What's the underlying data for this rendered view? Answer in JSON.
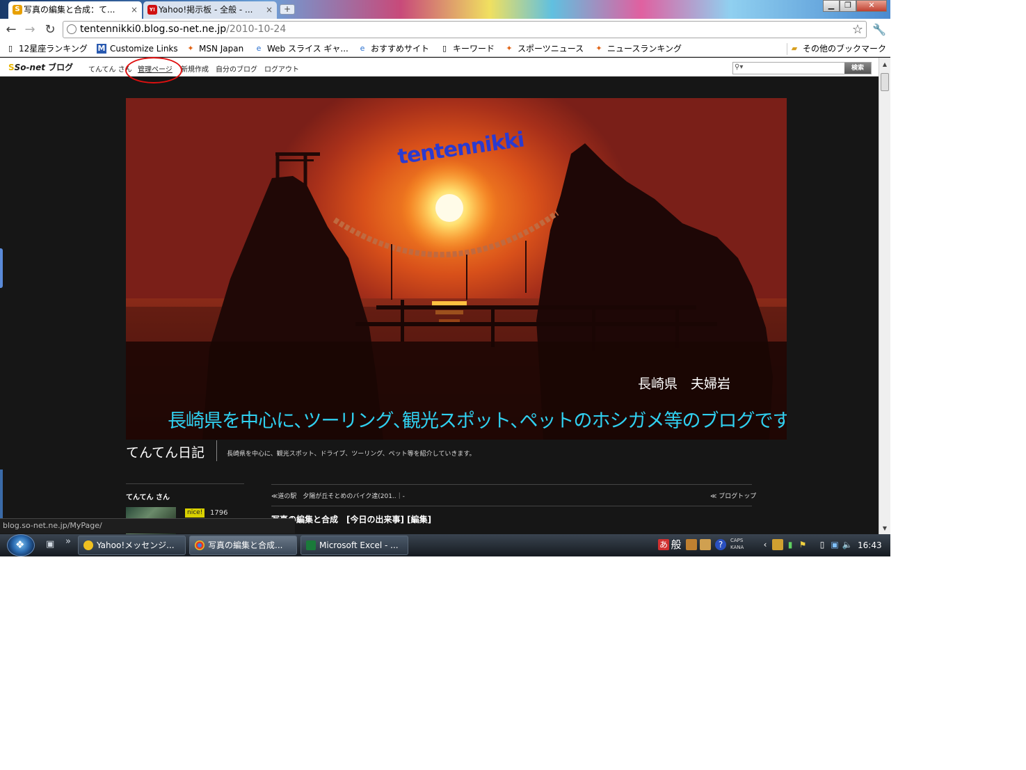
{
  "browser": {
    "tabs": [
      {
        "label": "写真の編集と合成：て...",
        "favicon": "S"
      },
      {
        "label": "Yahoo!掲示板 - 全般 - ...",
        "favicon": "Y!"
      }
    ],
    "address": {
      "host": "tentennikki0.blog.so-net.ne.jp",
      "path": "/2010-10-24"
    },
    "bookmarks": [
      "12星座ランキング",
      "Customize Links",
      "MSN Japan",
      "Web スライス ギャ...",
      "おすすめサイト",
      "キーワード",
      "スポーツニュース",
      "ニュースランキング"
    ],
    "other_bookmarks": "その他のブックマーク",
    "status_url": "blog.so-net.ne.jp/MyPage/"
  },
  "sonet": {
    "logo_brand": "So-net",
    "logo_blog": "ブログ",
    "links": [
      "てんてん さん",
      "管理ページ",
      "新規作成",
      "自分のブログ",
      "ログアウト"
    ],
    "search_button": "検索"
  },
  "header": {
    "logo_text": "tentennikki",
    "place": "長崎県　夫婦岩",
    "description": "長崎県を中心に､ツーリング､観光スポット､ペットのホシガメ等のブログです｡"
  },
  "blog": {
    "title": "てんてん日記",
    "subtitle": "長崎県を中心に、観光スポット、ドライブ、ツーリング、ペット等を紹介していきます。"
  },
  "sidebar": {
    "user": "てんてん さん",
    "nice_label": "nice!",
    "nice_count": "1796"
  },
  "post": {
    "prev_link": "≪道の駅　夕陽が丘そとめのバイク達(201..｜-",
    "blog_top": "≪ ブログトップ",
    "title": "写真の編集と合成　[今日の出来事] [編集]"
  },
  "taskbar": {
    "tasks": [
      "Yahoo!メッセンジ...",
      "写真の編集と合成...",
      "Microsoft Excel - ..."
    ],
    "ime": "般",
    "caps": "CAPS",
    "kana": "KANA",
    "clock": "16:43"
  },
  "colors": {
    "page_bg": "#161616",
    "caption_cyan": "#30d0f0",
    "logo_blue": "#2a3ad0",
    "annotation_red": "#e01010"
  }
}
